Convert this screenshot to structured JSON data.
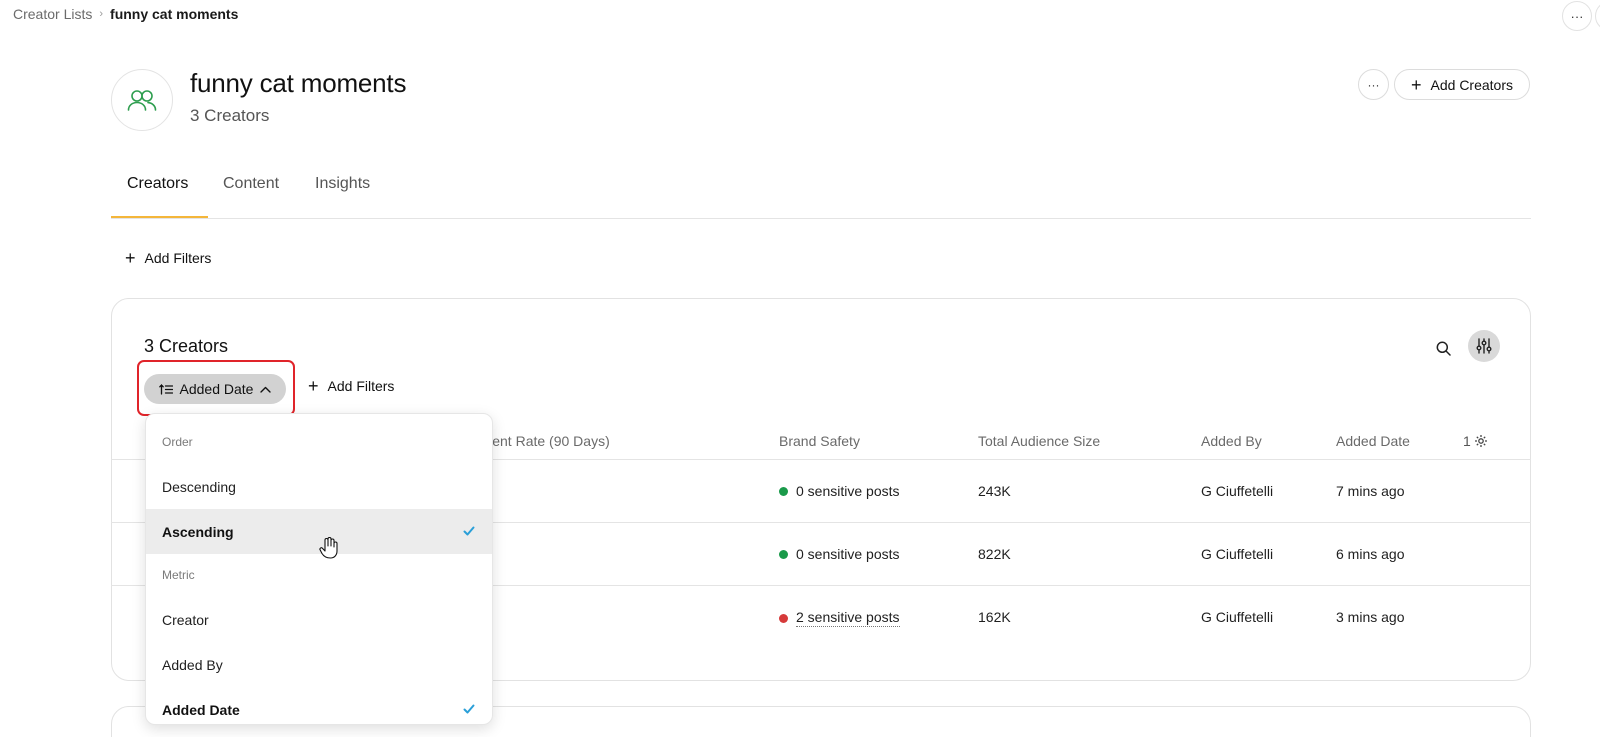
{
  "breadcrumb": {
    "parent": "Creator Lists",
    "separator": "›",
    "current": "funny cat moments"
  },
  "top_actions": {
    "more_label": "···"
  },
  "header": {
    "title": "funny cat moments",
    "subtitle": "3 Creators",
    "more_label": "···",
    "add_creators_label": "Add Creators",
    "accent_icon_color": "#2e9e4f"
  },
  "tabs": [
    {
      "label": "Creators",
      "active": true
    },
    {
      "label": "Content",
      "active": false
    },
    {
      "label": "Insights",
      "active": false
    }
  ],
  "filters": {
    "add_filters_label": "Add Filters"
  },
  "card": {
    "title": "3 Creators",
    "sort_label": "Added Date",
    "add_filters_label": "Add Filters",
    "highlight_color": "#e0242a"
  },
  "table": {
    "columns": [
      "gement Rate (90 Days)",
      "Brand Safety",
      "Total Audience Size",
      "Added By",
      "Added Date"
    ],
    "hidden_count": "1",
    "rows": [
      {
        "safety": "0 sensitive posts",
        "safety_color": "#1a9a4a",
        "audience": "243K",
        "added_by": "G Ciuffetelli",
        "added_date": "7 mins ago"
      },
      {
        "safety": "0 sensitive posts",
        "safety_color": "#1a9a4a",
        "audience": "822K",
        "added_by": "G Ciuffetelli",
        "added_date": "6 mins ago"
      },
      {
        "safety": "2 sensitive posts",
        "safety_color": "#d63a3a",
        "audience": "162K",
        "added_by": "G Ciuffetelli",
        "added_date": "3 mins ago"
      }
    ]
  },
  "sort_menu": {
    "order_header": "Order",
    "order_options": [
      {
        "label": "Descending",
        "selected": false
      },
      {
        "label": "Ascending",
        "selected": true
      }
    ],
    "metric_header": "Metric",
    "metric_options": [
      {
        "label": "Creator",
        "selected": false
      },
      {
        "label": "Added By",
        "selected": false
      },
      {
        "label": "Added Date",
        "selected": true
      }
    ],
    "check_color": "#2a9fd8"
  }
}
